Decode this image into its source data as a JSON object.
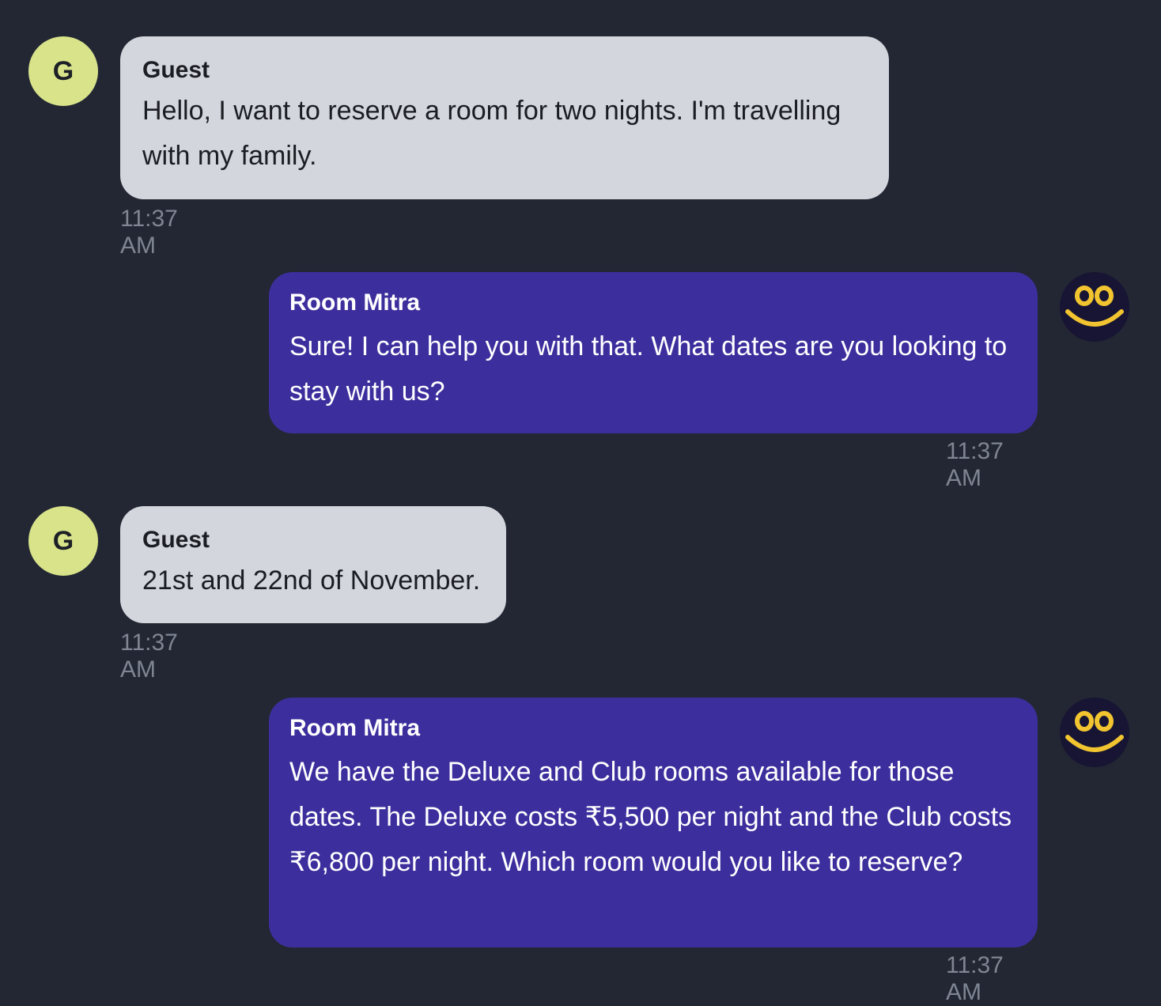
{
  "messages": [
    {
      "sender": "Guest",
      "avatar_letter": "G",
      "text": "Hello, I want to reserve a room for two nights. I'm travelling with my family.",
      "time": "11:37 AM"
    },
    {
      "sender": "Room Mitra",
      "avatar_icon": "smiley-face-icon",
      "text": "Sure! I can help you with that. What dates are you looking to stay with us?",
      "time": "11:37 AM"
    },
    {
      "sender": "Guest",
      "avatar_letter": "G",
      "text": "21st and 22nd of November.",
      "time": "11:37 AM"
    },
    {
      "sender": "Room Mitra",
      "avatar_icon": "smiley-face-icon",
      "text": "We have the Deluxe and Club rooms available for those dates. The Deluxe costs ₹5,500 per night and the Club costs ₹6,800 per night. Which room would you like to reserve?",
      "time": "11:37 AM"
    }
  ],
  "colors": {
    "background": "#222733",
    "guest_bubble": "#d3d6dd",
    "bot_bubble": "#3c2f9d",
    "guest_avatar": "#d8e38a",
    "bot_avatar": "#171533",
    "smiley": "#f2c530",
    "timestamp": "#7f8592"
  }
}
